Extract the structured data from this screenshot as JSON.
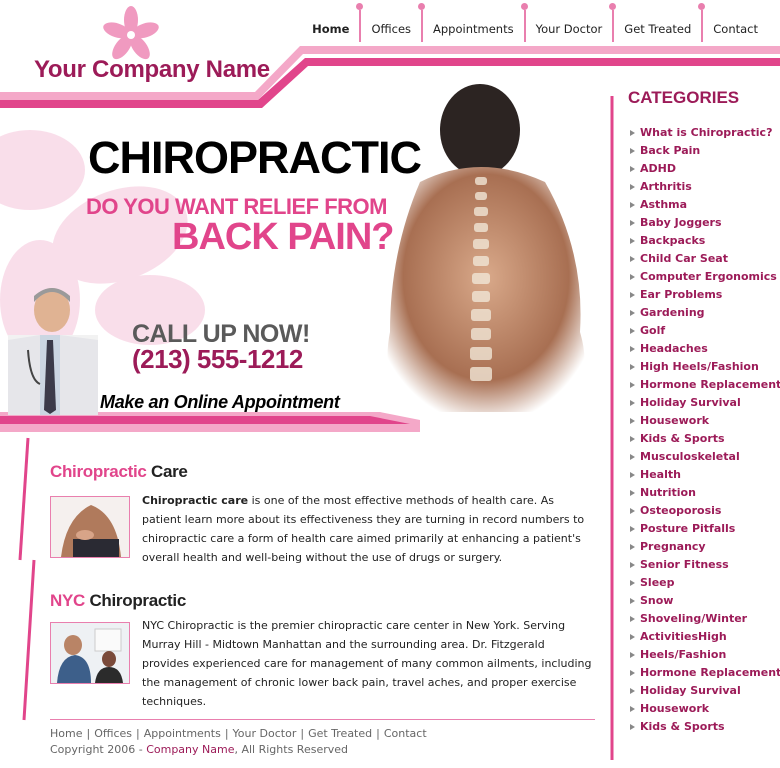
{
  "header": {
    "company_name": "Your Company Name",
    "nav": [
      "Home",
      "Offices",
      "Appointments",
      "Your Doctor",
      "Get Treated",
      "Contact"
    ]
  },
  "hero": {
    "headline": "CHIROPRACTIC",
    "question_line1": "DO YOU WANT RELIEF FROM",
    "question_line2": "BACK PAIN?",
    "call_up": "CALL UP NOW!",
    "phone": "(213) 555-1212",
    "appointment_link": "Make an Online Appointment"
  },
  "sidebar": {
    "title": "CATEGORIES",
    "items": [
      "What is Chiropractic?",
      "Back Pain",
      "ADHD",
      "Arthritis",
      "Asthma",
      "Baby Joggers",
      "Backpacks",
      "Child Car Seat",
      "Computer Ergonomics",
      "Ear Problems",
      "Gardening",
      "Golf",
      "Headaches",
      "High Heels/Fashion",
      "Hormone Replacement",
      "Holiday Survival",
      "Housework",
      "Kids & Sports",
      "Musculoskeletal",
      "Health",
      "Nutrition",
      "Osteoporosis",
      "Posture Pitfalls",
      "Pregnancy",
      "Senior Fitness",
      "Sleep",
      "Snow",
      "Shoveling/Winter",
      "ActivitiesHigh",
      "Heels/Fashion",
      "Hormone Replacement",
      "Holiday Survival",
      "Housework",
      "Kids & Sports"
    ]
  },
  "sections": [
    {
      "title_pink": "Chiropractic",
      "title_dark": "Care",
      "lead_bold": "Chiropractic care",
      "body": " is one of the most effective methods of health care. As patient learn more about its effectiveness they are turning in record numbers to chiropractic care a form of health care aimed primarily at enhancing a patient's overall health and well-being without the use of drugs or surgery."
    },
    {
      "title_pink": "NYC",
      "title_dark": "Chiropractic",
      "body": "NYC Chiropractic is the premier chiropractic care center in New York. Serving Murray Hill - Midtown Manhattan and the surrounding area. Dr. Fitzgerald provides experienced care for management of many common ailments, including the management of chronic lower back pain, travel aches, and proper exercise techniques."
    }
  ],
  "footer": {
    "links": [
      "Home",
      "Offices",
      "Appointments",
      "Your Doctor",
      "Get Treated",
      "Contact"
    ],
    "copyright_prefix": "Copyright 2006 - ",
    "company_name": "Company Name",
    "copyright_suffix": ", All Rights Reserved"
  },
  "colors": {
    "accent_pink": "#e1458b",
    "brand_plum": "#9c1b58",
    "light_pink": "#e97fae"
  }
}
